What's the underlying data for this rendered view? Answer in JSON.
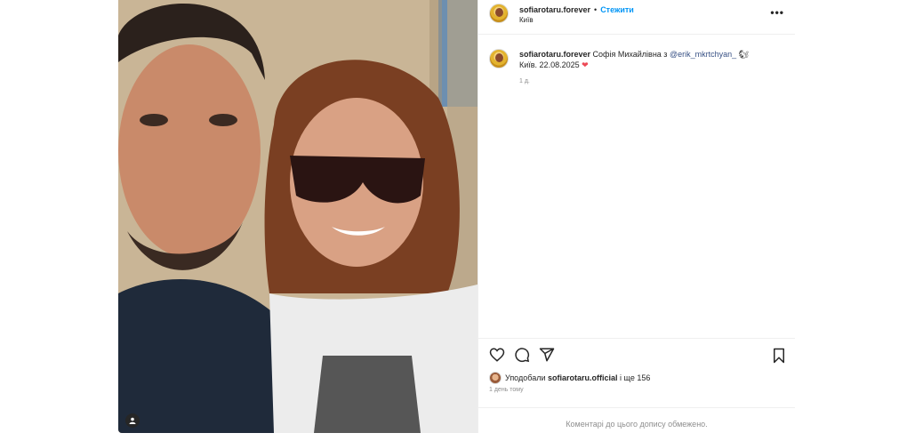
{
  "header": {
    "username": "sofiarotaru.forever",
    "separator": "•",
    "follow_label": "Стежити",
    "location": "Київ",
    "more_icon": "more-horizontal-icon"
  },
  "caption": {
    "username": "sofiarotaru.forever",
    "text_before": "Софія Михайлівна з",
    "mention": "@erik_mkrtchyan_",
    "emoji": "🐿",
    "line2": "Київ. 22.08.2025",
    "heart": "❤",
    "age": "1 д."
  },
  "actions": {
    "like_icon": "heart-icon",
    "comment_icon": "comment-icon",
    "share_icon": "share-icon",
    "save_icon": "bookmark-icon"
  },
  "likes": {
    "prefix": "Уподобали",
    "user": "sofiarotaru.official",
    "suffix": "і ще 156"
  },
  "posted_ago": "1 день тому",
  "comments_notice": "Коментарі до цього допису обмежено.",
  "colors": {
    "accent": "#0095f6",
    "heart": "#ed4956",
    "muted": "#8e8e8e"
  }
}
